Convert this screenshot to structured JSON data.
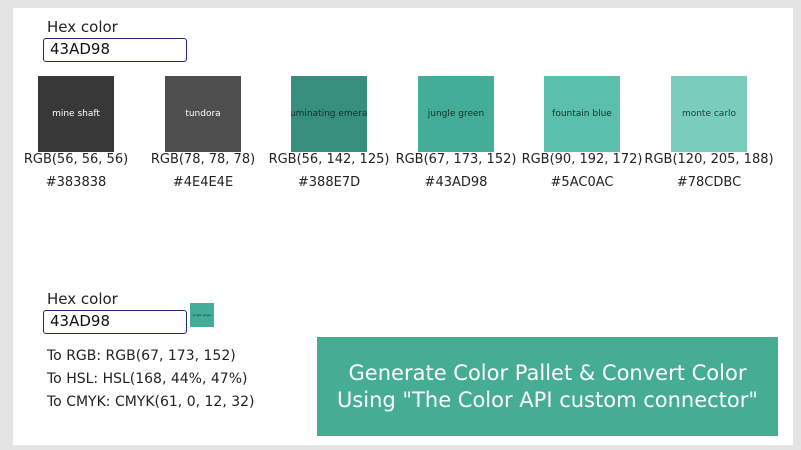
{
  "palette_section": {
    "label": "Hex color",
    "input_value": "43AD98",
    "swatches": [
      {
        "name": "mine shaft",
        "rgb": "RGB(56, 56, 56)",
        "hex": "#383838",
        "color": "#383838",
        "text_color": "#ffffff"
      },
      {
        "name": "tundora",
        "rgb": "RGB(78, 78, 78)",
        "hex": "#4E4E4E",
        "color": "#4E4E4E",
        "text_color": "#ffffff"
      },
      {
        "name": "illuminating emerald",
        "rgb": "RGB(56, 142, 125)",
        "hex": "#388E7D",
        "color": "#388E7D",
        "text_color": "#10302a"
      },
      {
        "name": "jungle green",
        "rgb": "RGB(67, 173, 152)",
        "hex": "#43AD98",
        "color": "#43AD98",
        "text_color": "#10302a"
      },
      {
        "name": "fountain blue",
        "rgb": "RGB(90, 192, 172)",
        "hex": "#5AC0AC",
        "color": "#5AC0AC",
        "text_color": "#10302a"
      },
      {
        "name": "monte carlo",
        "rgb": "RGB(120, 205, 188)",
        "hex": "#78CDBC",
        "color": "#78CDBC",
        "text_color": "#1b3e37"
      }
    ]
  },
  "convert_section": {
    "label": "Hex color",
    "input_value": "43AD98",
    "preview_name": "jungle green",
    "preview_color": "#43AD98",
    "to_rgb": "To RGB: RGB(67, 173, 152)",
    "to_hsl": "To HSL: HSL(168, 44%, 47%)",
    "to_cmyk": "To CMYK: CMYK(61, 0, 12, 32)"
  },
  "banner": {
    "line1": "Generate Color Pallet & Convert Color",
    "line2": "Using \"The Color API custom connector\"",
    "color": "#46ad95"
  }
}
